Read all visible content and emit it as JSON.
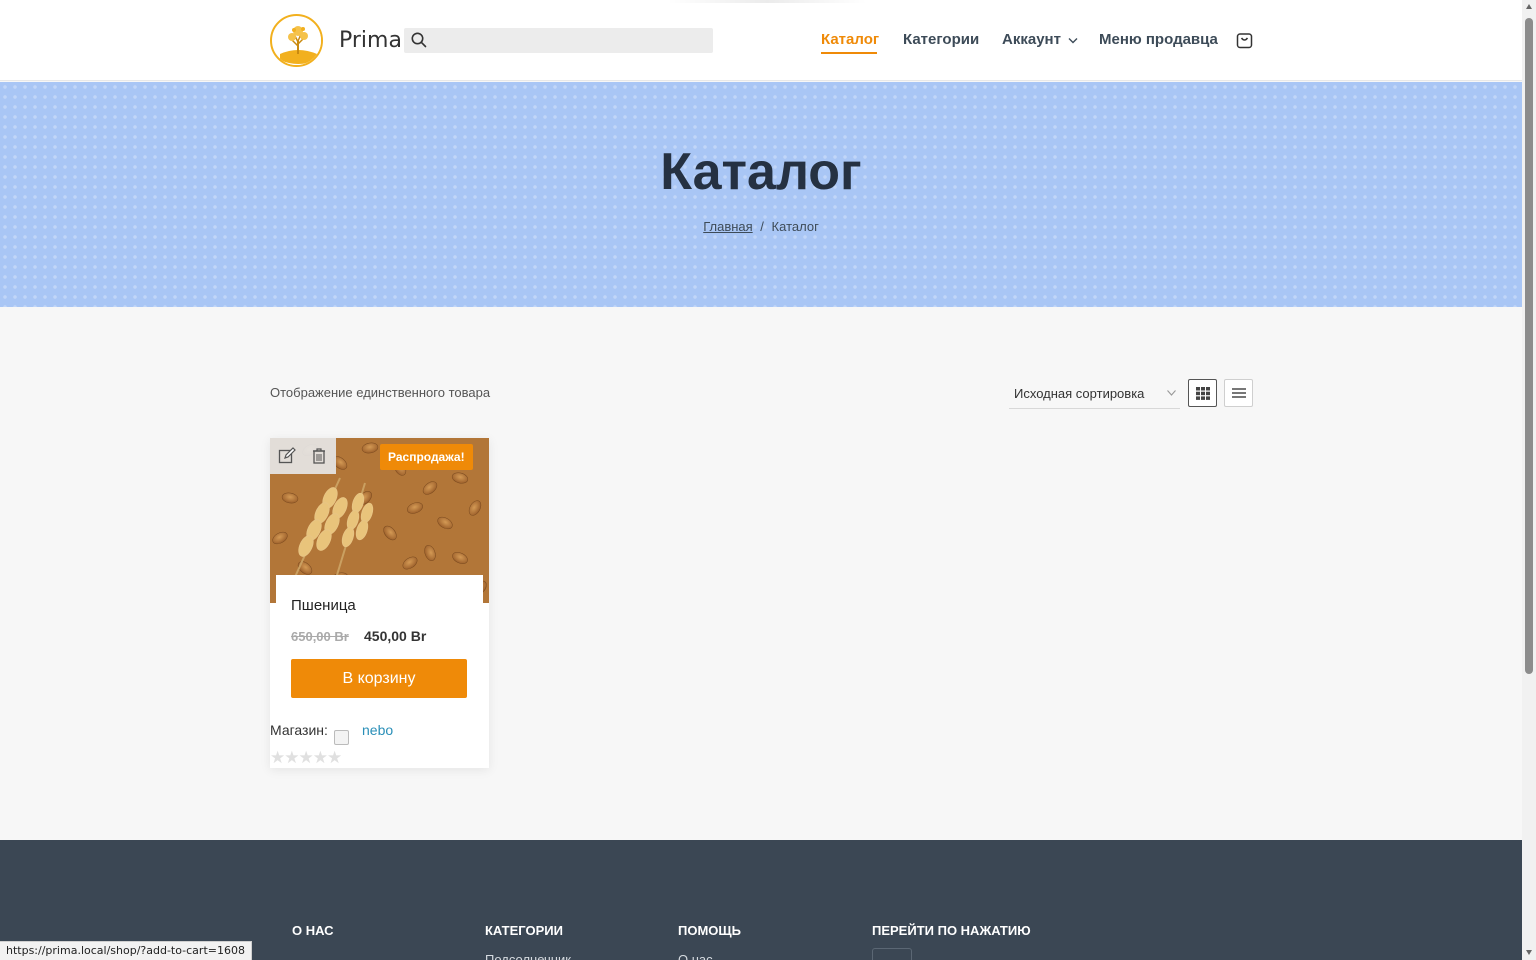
{
  "header": {
    "brand": "Prima",
    "search": {
      "placeholder": "",
      "value": ""
    },
    "nav": {
      "catalog": "Каталог",
      "categories": "Категории",
      "account": "Аккаунт",
      "seller_menu": "Меню продавца"
    },
    "icons": [
      "logo-tree",
      "search-icon",
      "chevron-down-icon",
      "shopping-bag-icon"
    ]
  },
  "hero": {
    "title": "Каталог",
    "breadcrumb": {
      "home": "Главная",
      "separator": "/",
      "current": "Каталог"
    }
  },
  "shop_toolbar": {
    "result_count": "Отображение единственного товара",
    "sort_selected": "Исходная сортировка",
    "view_modes": [
      "grid",
      "list"
    ],
    "active_view": "grid"
  },
  "products": [
    {
      "name": "Пшеница",
      "badge": "Распродажа!",
      "price_old": "650,00 Br",
      "price_new": "450,00 Br",
      "add_to_cart": "В корзину",
      "store_label": "Магазин:",
      "store_name": "nebo",
      "rating": 0,
      "rating_max": 5,
      "admin_tools": [
        "edit-icon",
        "trash-icon"
      ]
    }
  ],
  "footer": {
    "columns": [
      {
        "heading": "О НАС",
        "link": ""
      },
      {
        "heading": "КАТЕГОРИИ",
        "link": "Подсолнечник"
      },
      {
        "heading": "ПОМОЩЬ",
        "link": "О нас"
      },
      {
        "heading": "ПЕРЕЙТИ ПО НАЖАТИЮ",
        "link": ""
      }
    ]
  },
  "status_bar": {
    "url": "https://prima.local/shop/?add-to-cart=1608"
  },
  "colors": {
    "accent": "#ef8a08",
    "hero_bg": "#a9c6f5",
    "footer_bg": "#3b4754",
    "nav_text": "#3d4b58",
    "link": "#2a8fb8"
  }
}
